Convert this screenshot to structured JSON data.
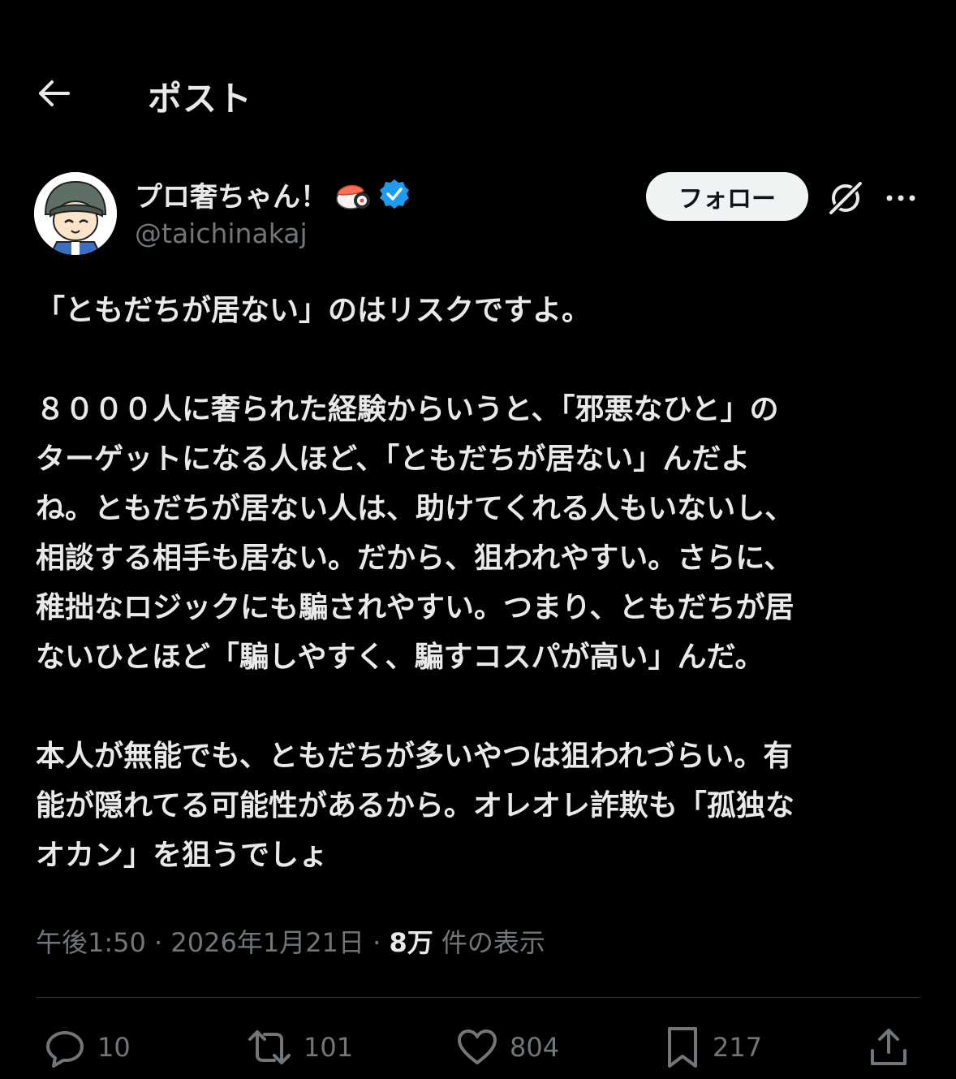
{
  "header": {
    "title": "ポスト",
    "back_icon": "arrow-left-icon"
  },
  "author": {
    "display_name": "プロ奢ちゃん！",
    "handle": "@taichinakaj",
    "emoji_icon": "sushi-icon",
    "verified": true,
    "verified_color": "#1d9bf0"
  },
  "actions_top": {
    "follow_label": "フォロー",
    "grok_icon": "grok-icon",
    "more_icon": "more-icon"
  },
  "post": {
    "paragraphs": [
      "「ともだちが居ない」のはリスクですよ。",
      "８０００人に奢られた経験からいうと、「邪悪なひと」の\nターゲットになる人ほど、「ともだちが居ない」んだよ\nね。ともだちが居ない人は、助けてくれる人もいないし、\n相談する相手も居ない。だから、狙われやすい。さらに、\n稚拙なロジックにも騙されやすい。つまり、ともだちが居\nないひとほど「騙しやすく、騙すコスパが高い」んだ。",
      "本人が無能でも、ともだちが多いやつは狙われづらい。有\n能が隠れてる可能性があるから。オレオレ詐欺も「孤独な\nオカン」を狙うでしょ"
    ]
  },
  "meta": {
    "time": "午後1:50",
    "separator1": " · ",
    "date": "2026年1月21日",
    "separator2": " · ",
    "views_count": "8万",
    "views_label": " 件の表示"
  },
  "engagement": {
    "replies": "10",
    "reposts": "101",
    "likes": "804",
    "bookmarks": "217"
  },
  "colors": {
    "background": "#000000",
    "text": "#e7e9ea",
    "secondary": "#71767b",
    "divider": "#2f3336"
  }
}
